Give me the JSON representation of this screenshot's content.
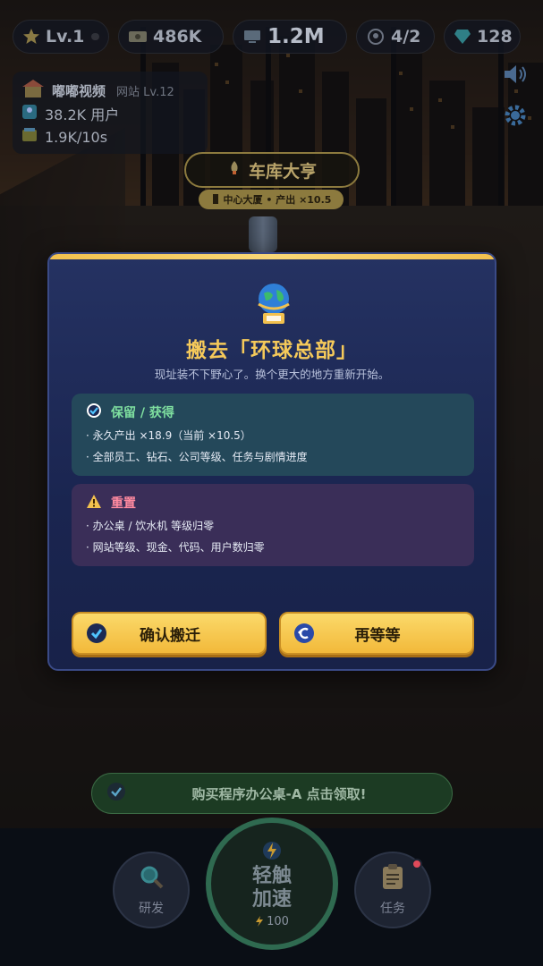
{
  "hud": {
    "level": "Lv.1",
    "cash": "486K",
    "code": "1.2M",
    "staff": "4/2",
    "gems": "128"
  },
  "site": {
    "name": "嘟嘟视频",
    "level": "网站 Lv.12",
    "users": "38.2K 用户",
    "rate": "1.9K/10s"
  },
  "location": {
    "title": "车库大亨",
    "next_hint": "中心大厦 • 产出 ×10.5"
  },
  "modal": {
    "title": "搬去「环球总部」",
    "subtitle": "现址装不下野心了。换个更大的地方重新开始。",
    "keep": {
      "heading": "保留 / 获得",
      "lines": [
        "· 永久产出 ×18.9（当前 ×10.5）",
        "· 全部员工、钻石、公司等级、任务与剧情进度"
      ]
    },
    "reset": {
      "heading": "重置",
      "lines": [
        "· 办公桌 / 饮水机 等级归零",
        "· 网站等级、现金、代码、用户数归零"
      ]
    },
    "confirm_label": "确认搬迁",
    "wait_label": "再等等"
  },
  "quest": {
    "text": "购买程序办公桌-A  点击领取!"
  },
  "dock": {
    "research_label": "研发",
    "boost_label_1": "轻触",
    "boost_label_2": "加速",
    "boost_cost": "100",
    "task_label": "任务"
  },
  "colors": {
    "accent_gold": "#f5c95a",
    "modal_bg": "#1f2b58",
    "keep_green": "#7fe0a0",
    "reset_pink": "#ff8aa0"
  }
}
